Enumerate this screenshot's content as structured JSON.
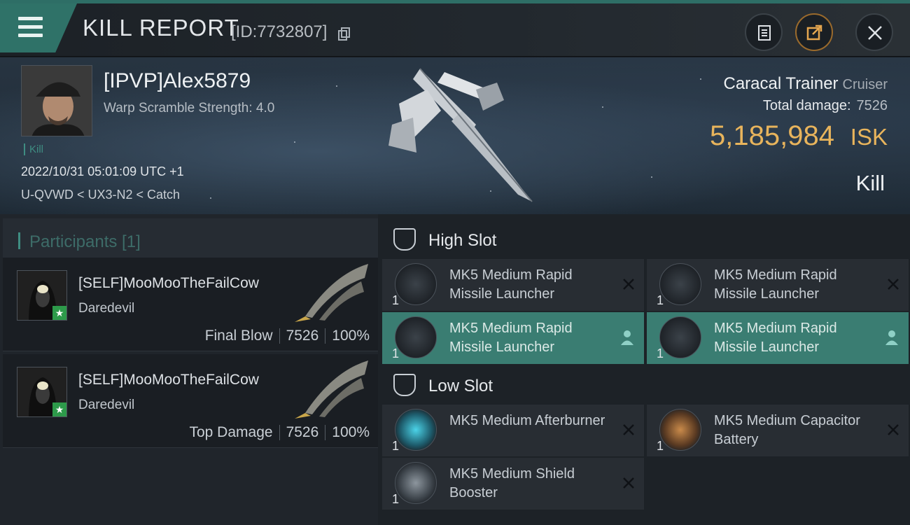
{
  "header": {
    "title": "KILL REPORT",
    "id_text": "[ID:7732807]"
  },
  "victim": {
    "name": "[IPVP]Alex5879",
    "scramble": "Warp Scramble Strength: 4.0",
    "kill_tag": "Kill",
    "datetime": "2022/10/31 05:01:09 UTC +1",
    "location": "U-QVWD < UX3-N2 < Catch",
    "ship_name": "Caracal Trainer",
    "ship_class": "Cruiser",
    "total_damage_label": "Total damage:",
    "total_damage": "7526",
    "isk_value": "5,185,984",
    "isk_unit": "ISK",
    "result": "Kill"
  },
  "participants": {
    "header": "Participants [1]",
    "rows": [
      {
        "name": "[SELF]MooMooTheFailCow",
        "ship": "Daredevil",
        "role": "Final Blow",
        "damage": "7526",
        "percent": "100%"
      },
      {
        "name": "[SELF]MooMooTheFailCow",
        "ship": "Daredevil",
        "role": "Top Damage",
        "damage": "7526",
        "percent": "100%"
      }
    ]
  },
  "slots": {
    "high_title": "High Slot",
    "low_title": "Low Slot",
    "high": [
      {
        "name": "MK5 Medium Rapid Missile Launcher",
        "qty": "1",
        "state": "destroyed"
      },
      {
        "name": "MK5 Medium Rapid Missile Launcher",
        "qty": "1",
        "state": "destroyed"
      },
      {
        "name": "MK5 Medium Rapid Missile Launcher",
        "qty": "1",
        "state": "dropped"
      },
      {
        "name": "MK5 Medium Rapid Missile Launcher",
        "qty": "1",
        "state": "dropped"
      }
    ],
    "low": [
      {
        "name": "MK5 Medium Afterburner",
        "qty": "1",
        "state": "destroyed"
      },
      {
        "name": "MK5 Medium Capacitor Battery",
        "qty": "1",
        "state": "destroyed"
      },
      {
        "name": "MK5 Medium Shield Booster",
        "qty": "1",
        "state": "destroyed"
      }
    ]
  },
  "icons": {
    "menu": "hamburger-menu-icon",
    "copy": "copy-icon",
    "clipboard": "clipboard-icon",
    "share": "share-icon",
    "close": "close-icon",
    "slot": "slot-icon",
    "destroyed": "close-x-icon",
    "dropped": "pilot-icon"
  },
  "colors": {
    "accent": "#3f8d82",
    "isk": "#e8b45c",
    "active_module": "#3a7d72"
  }
}
